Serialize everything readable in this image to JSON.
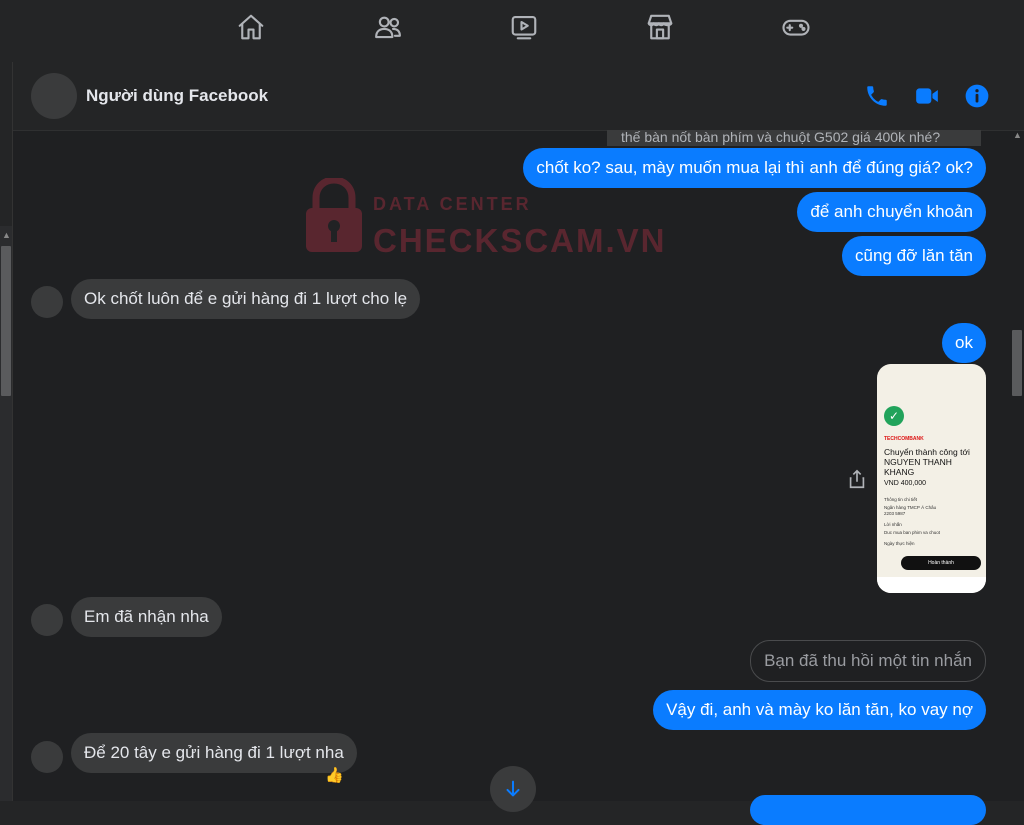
{
  "topnav": {
    "items": [
      {
        "icon": "home-icon"
      },
      {
        "icon": "friends-icon"
      },
      {
        "icon": "watch-icon"
      },
      {
        "icon": "marketplace-icon"
      },
      {
        "icon": "gaming-icon"
      }
    ]
  },
  "header": {
    "contact_name": "Người dùng Facebook",
    "accent": "#0a7cff"
  },
  "watermark": {
    "top": "DATA CENTER",
    "main": "CHECKSCAM.VN"
  },
  "messages": {
    "faded_top": "thế bàn nốt bàn phím và chuột G502 giá 400k nhé?",
    "m1": "chốt ko? sau, mày muốn mua lại thì anh để đúng giá? ok?",
    "m2": "để anh chuyển khoản",
    "m3": "cũng đỡ lăn tăn",
    "m4": "Ok chốt luôn để e gửi hàng đi 1 lượt cho lẹ",
    "m5": "ok",
    "m6": "Em đã nhận nha",
    "m7": "Bạn đã thu hồi một tin nhắn",
    "m8": "Vậy đi, anh và mày ko lăn tăn, ko vay nợ",
    "m9": "Để 20 tây e gửi hàng đi 1 lượt nha",
    "m9_reaction": "👍"
  },
  "receipt": {
    "bank": "TECHCOMBANK",
    "title": "Chuyển thành công tới NGUYEN THANH KHANG",
    "amount": "VND 400,000",
    "detail_label": "Thông tin chi tiết",
    "bank_name": "Ngân hàng TMCP Á Châu",
    "account": "2203 5987",
    "note_label": "Lời nhắn",
    "note": "Duc mua ban phim va chuot",
    "date_label": "Ngày thực hiện",
    "done": "Hoàn thành"
  }
}
